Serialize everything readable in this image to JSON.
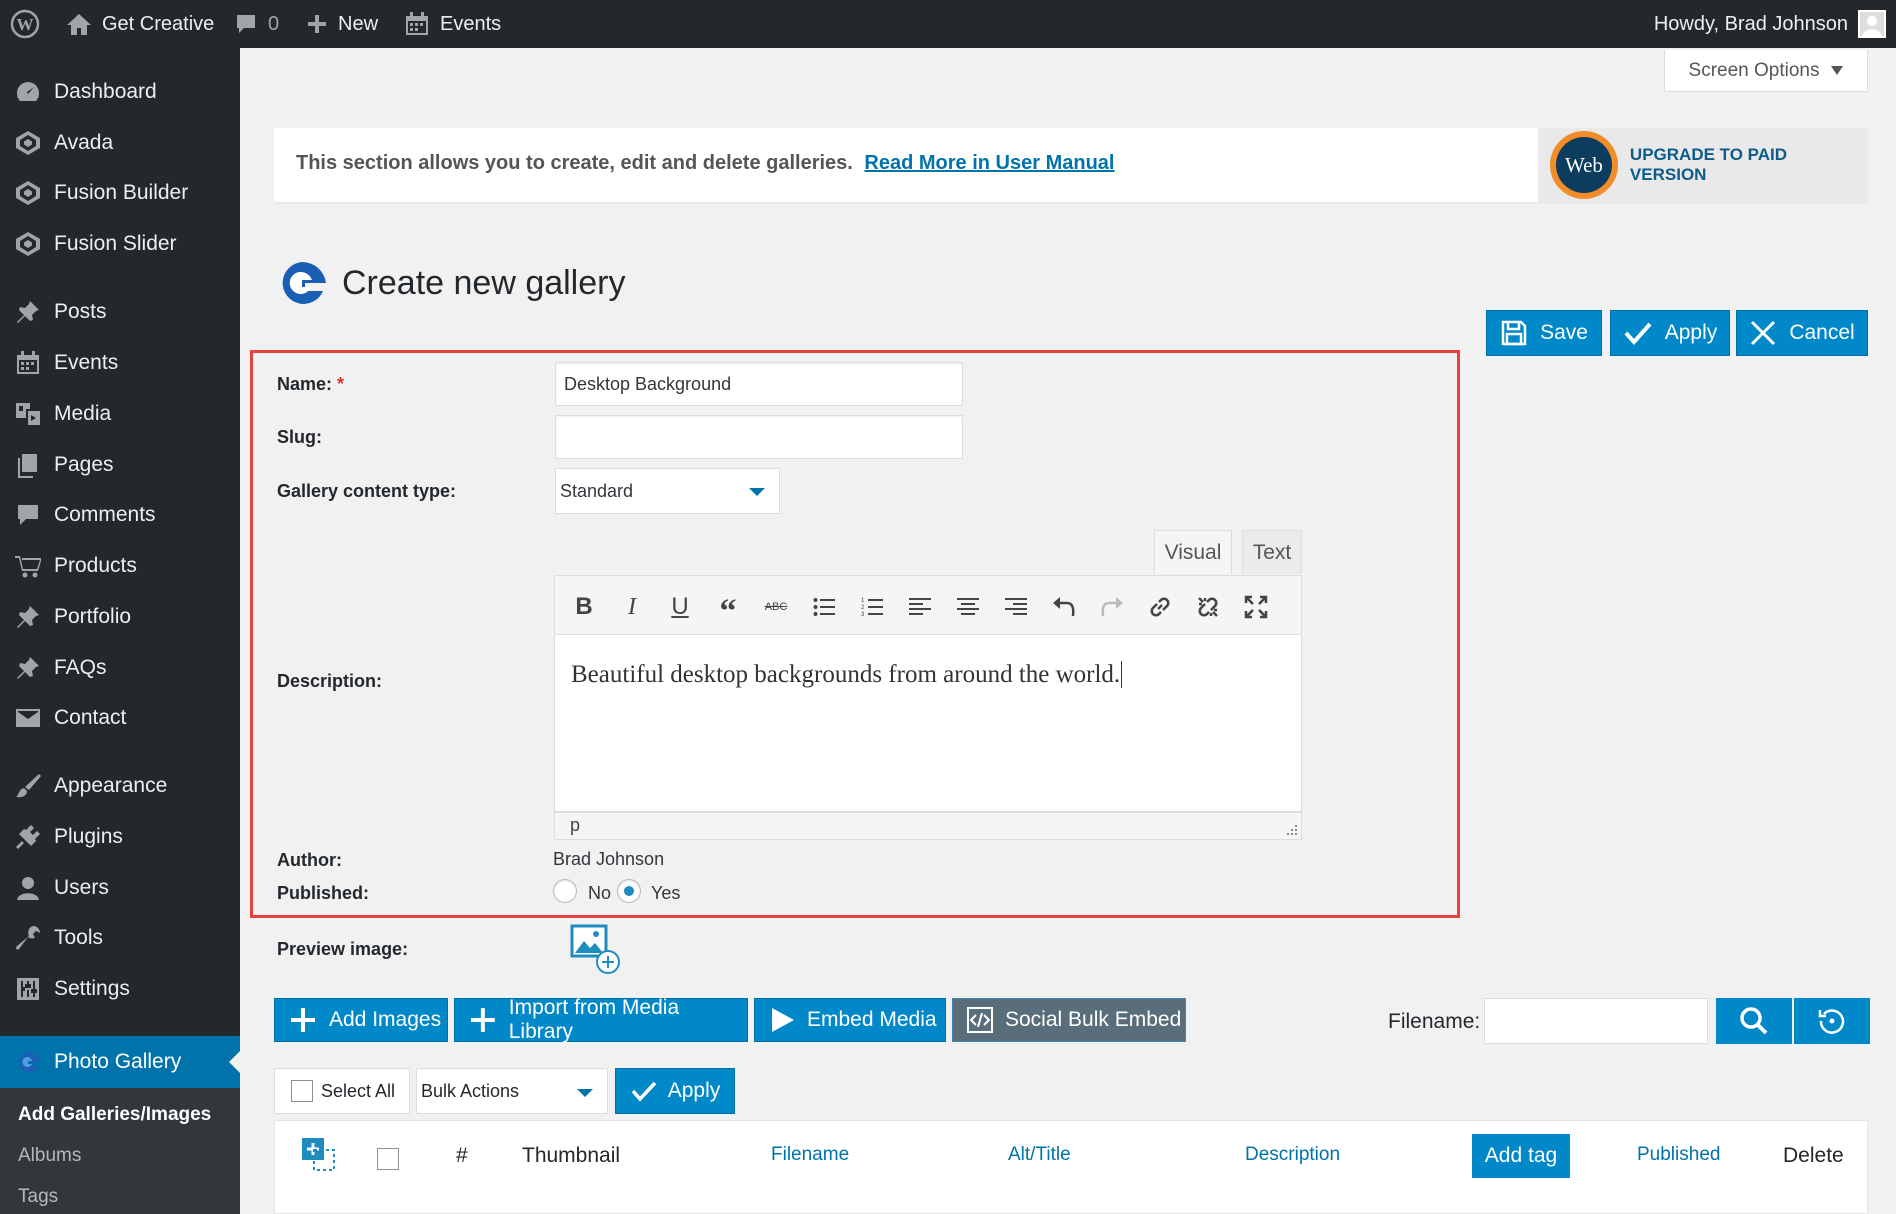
{
  "adminbar": {
    "site_name": "Get Creative",
    "comments_count": "0",
    "new_label": "New",
    "events_label": "Events",
    "howdy": "Howdy, Brad Johnson"
  },
  "sidebar": {
    "items": [
      {
        "label": "Dashboard",
        "icon": "dashboard-icon"
      },
      {
        "label": "Avada",
        "icon": "avada-icon"
      },
      {
        "label": "Fusion Builder",
        "icon": "fusion-builder-icon"
      },
      {
        "label": "Fusion Slider",
        "icon": "fusion-slider-icon"
      },
      {
        "label": "Posts",
        "icon": "pin-icon"
      },
      {
        "label": "Events",
        "icon": "calendar-icon"
      },
      {
        "label": "Media",
        "icon": "media-icon"
      },
      {
        "label": "Pages",
        "icon": "pages-icon"
      },
      {
        "label": "Comments",
        "icon": "comment-icon"
      },
      {
        "label": "Products",
        "icon": "cart-icon"
      },
      {
        "label": "Portfolio",
        "icon": "pin-icon"
      },
      {
        "label": "FAQs",
        "icon": "pin-icon"
      },
      {
        "label": "Contact",
        "icon": "mail-icon"
      },
      {
        "label": "Appearance",
        "icon": "brush-icon"
      },
      {
        "label": "Plugins",
        "icon": "plug-icon"
      },
      {
        "label": "Users",
        "icon": "user-icon"
      },
      {
        "label": "Tools",
        "icon": "wrench-icon"
      },
      {
        "label": "Settings",
        "icon": "sliders-icon"
      },
      {
        "label": "Photo Gallery",
        "icon": "photo-gallery-icon"
      }
    ],
    "submenu": [
      "Add Galleries/Images",
      "Albums",
      "Tags"
    ]
  },
  "screen_options": "Screen Options",
  "notice": {
    "text": "This section allows you to create, edit and delete galleries.",
    "link": "Read More in User Manual",
    "upgrade_logo": "Web",
    "upgrade_label": "UPGRADE TO PAID VERSION"
  },
  "page_title": "Create new gallery",
  "buttons": {
    "save": "Save",
    "apply": "Apply",
    "cancel": "Cancel"
  },
  "form": {
    "name_label": "Name:",
    "required_mark": "*",
    "name_value": "Desktop Background",
    "slug_label": "Slug:",
    "slug_value": "",
    "content_type_label": "Gallery content type:",
    "content_type_value": "Standard",
    "description_label": "Description:",
    "tab_visual": "Visual",
    "tab_text": "Text",
    "description_value": "Beautiful desktop backgrounds from around the world.",
    "editor_path": "p",
    "author_label": "Author:",
    "author_value": "Brad Johnson",
    "published_label": "Published:",
    "published_no": "No",
    "published_yes": "Yes",
    "published_selected": "Yes",
    "preview_label": "Preview image:"
  },
  "toolbar_icons": [
    "bold-icon",
    "italic-icon",
    "underline-icon",
    "blockquote-icon",
    "strikethrough-icon",
    "bullet-list-icon",
    "numbered-list-icon",
    "align-left-icon",
    "align-center-icon",
    "align-right-icon",
    "undo-icon",
    "redo-icon",
    "link-icon",
    "unlink-icon",
    "fullscreen-icon"
  ],
  "actions": {
    "add_images": "Add Images",
    "import_media": "Import from Media Library",
    "embed_media": "Embed Media",
    "social_bulk_embed": "Social Bulk Embed",
    "filename_label": "Filename:",
    "filename_value": ""
  },
  "bulk": {
    "select_all": "Select All",
    "bulk_actions": "Bulk Actions",
    "apply": "Apply"
  },
  "table": {
    "columns": [
      "#",
      "Thumbnail",
      "Filename",
      "Alt/Title",
      "Description",
      "Add tag",
      "Published",
      "Delete"
    ]
  },
  "colors": {
    "accent": "#0088c8",
    "admin_bar": "#23282d",
    "highlight_border": "#e5413f",
    "link": "#0073aa"
  }
}
